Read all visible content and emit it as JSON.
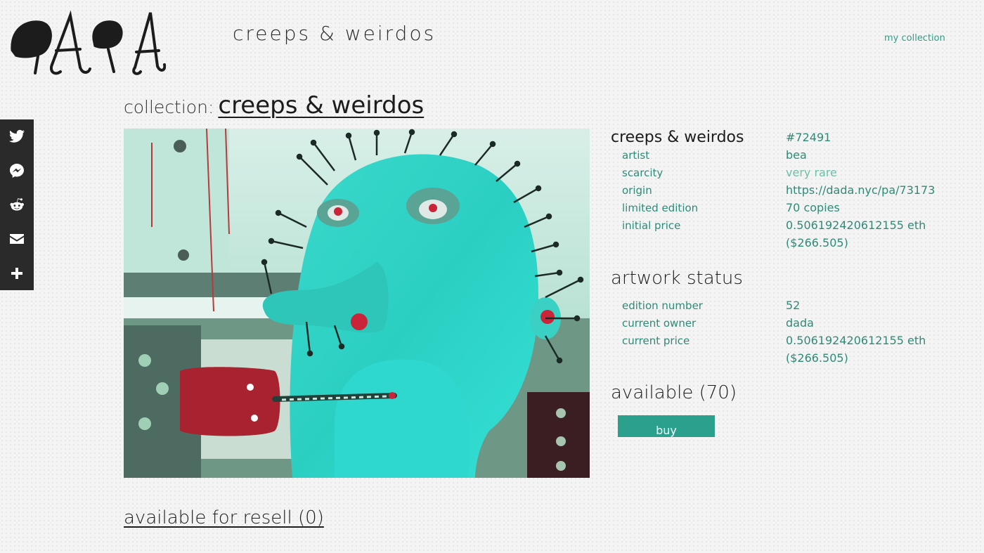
{
  "header": {
    "logo_text": "dada",
    "site_title": "creeps & weirdos",
    "nav": {
      "my_collection": "my collection"
    }
  },
  "share": {
    "items": [
      {
        "icon": "twitter-icon"
      },
      {
        "icon": "messenger-icon"
      },
      {
        "icon": "reddit-icon"
      },
      {
        "icon": "email-icon"
      },
      {
        "icon": "plus-icon"
      }
    ]
  },
  "collection": {
    "prefix": "collection:",
    "name": "creeps & weirdos"
  },
  "artwork": {
    "title": "creeps & weirdos",
    "id": "#72491",
    "details": [
      {
        "label": "artist",
        "value": "bea"
      },
      {
        "label": "scarcity",
        "value": "very rare"
      },
      {
        "label": "origin",
        "value": "https://dada.nyc/pa/73173"
      },
      {
        "label": "limited edition",
        "value": "70 copies"
      },
      {
        "label": "initial price",
        "value": "0.506192420612155 eth",
        "value2": "($266.505)"
      }
    ]
  },
  "status": {
    "title": "artwork status",
    "details": [
      {
        "label": "edition number",
        "value": "52"
      },
      {
        "label": "current owner",
        "value": "dada"
      },
      {
        "label": "current price",
        "value": "0.506192420612155 eth",
        "value2": "($266.505)"
      }
    ]
  },
  "availability": {
    "title": "available (70)",
    "buy_label": "buy",
    "resell": "available for resell (0)"
  },
  "colors": {
    "accent": "#2ba08d",
    "link": "#2f8a77",
    "dark": "#2a2a2a"
  }
}
